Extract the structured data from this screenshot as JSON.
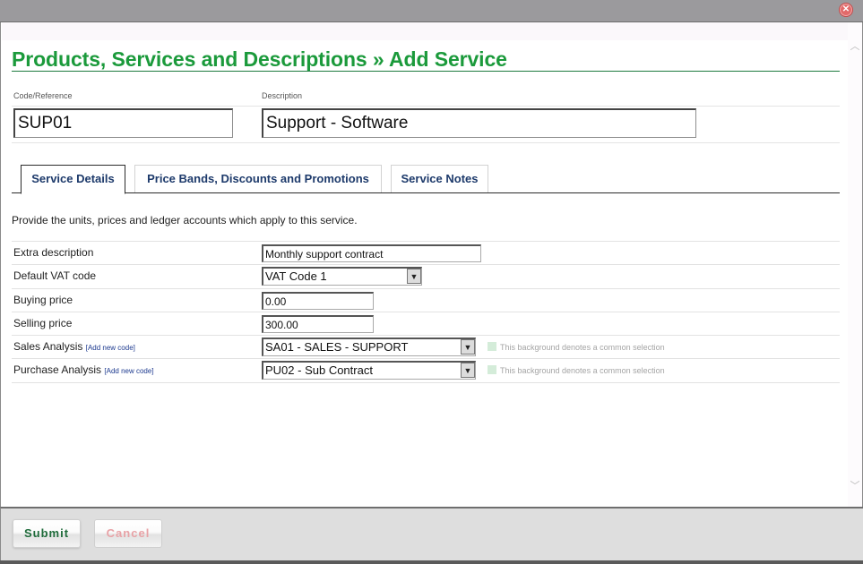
{
  "window": {
    "close_icon": "close-circle-icon"
  },
  "page": {
    "title": "Products, Services and Descriptions » Add Service"
  },
  "header_fields": {
    "code": {
      "label": "Code/Reference",
      "value": "SUP01"
    },
    "description": {
      "label": "Description",
      "value": "Support - Software"
    }
  },
  "tabs": [
    {
      "label": "Service Details",
      "active": true
    },
    {
      "label": "Price Bands, Discounts and Promotions",
      "active": false
    },
    {
      "label": "Service Notes",
      "active": false
    }
  ],
  "intro": "Provide the units, prices and ledger accounts which apply to this service.",
  "form": {
    "extra_description": {
      "label": "Extra description",
      "value": "Monthly support contract"
    },
    "vat_code": {
      "label": "Default VAT code",
      "value": "VAT Code 1"
    },
    "buying_price": {
      "label": "Buying price",
      "value": "0.00"
    },
    "selling_price": {
      "label": "Selling price",
      "value": "300.00"
    },
    "sales_analysis": {
      "label": "Sales Analysis",
      "link": "[Add new code]",
      "value": "SA01 - SALES - SUPPORT",
      "hint": "This background denotes a common selection"
    },
    "purchase_analysis": {
      "label": "Purchase Analysis",
      "link": "[Add new code]",
      "value": "PU02 - Sub Contract",
      "hint": "This background denotes a common selection"
    }
  },
  "buttons": {
    "submit": "Submit",
    "cancel": "Cancel"
  },
  "colors": {
    "title_green": "#1b9a3b",
    "tab_text": "#1d3a6b",
    "common_selection_swatch": "#d4ecd9",
    "submit_text": "#1e6b3a",
    "cancel_text": "#e8a2a6"
  }
}
